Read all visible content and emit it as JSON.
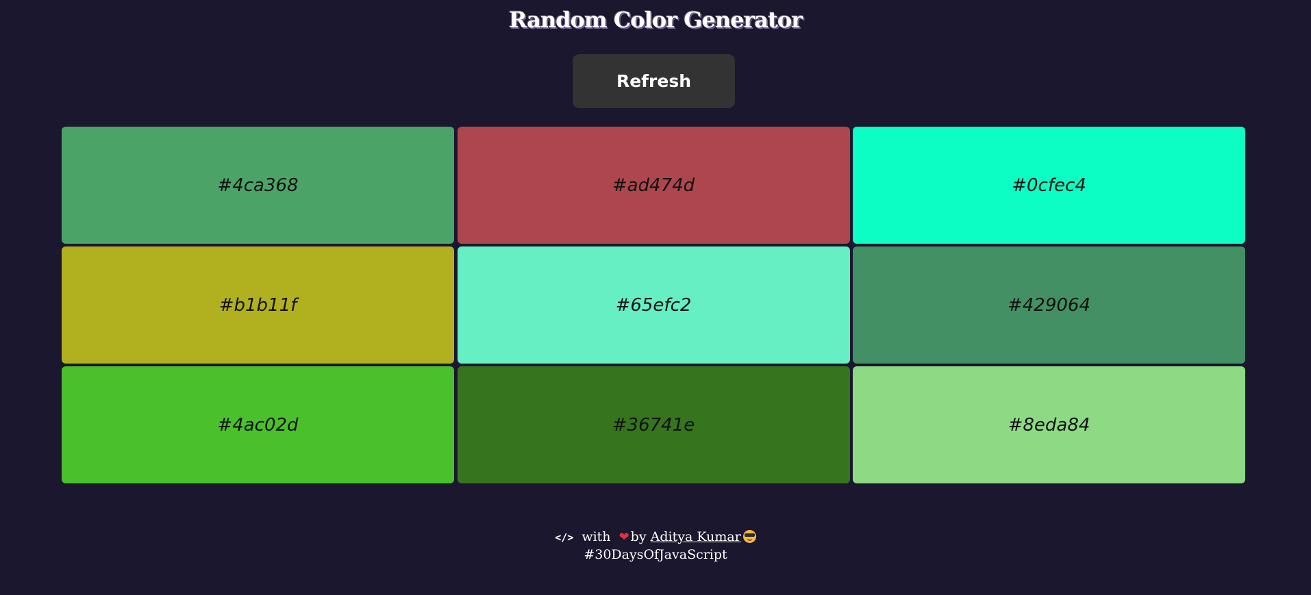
{
  "header": {
    "title": "Random Color Generator"
  },
  "controls": {
    "refresh_label": "Refresh"
  },
  "swatches": [
    {
      "hex": "#4ca368"
    },
    {
      "hex": "#ad474d"
    },
    {
      "hex": "#0cfec4"
    },
    {
      "hex": "#b1b11f"
    },
    {
      "hex": "#65efc2"
    },
    {
      "hex": "#429064"
    },
    {
      "hex": "#4ac02d"
    },
    {
      "hex": "#36741e"
    },
    {
      "hex": "#8eda84"
    }
  ],
  "footer": {
    "code_symbol": "</>",
    "with_text": "with",
    "heart_symbol": "❤",
    "by_text": "by",
    "author": "Aditya Kumar",
    "hashtag": "#30DaysOfJavaScript"
  },
  "colors": {
    "background": "#1a172e",
    "button": "#333333",
    "text": "#ffffff"
  },
  "icons": {
    "code": "code-icon",
    "heart": "heart-icon",
    "emoji": "star-struck-emoji-icon"
  }
}
